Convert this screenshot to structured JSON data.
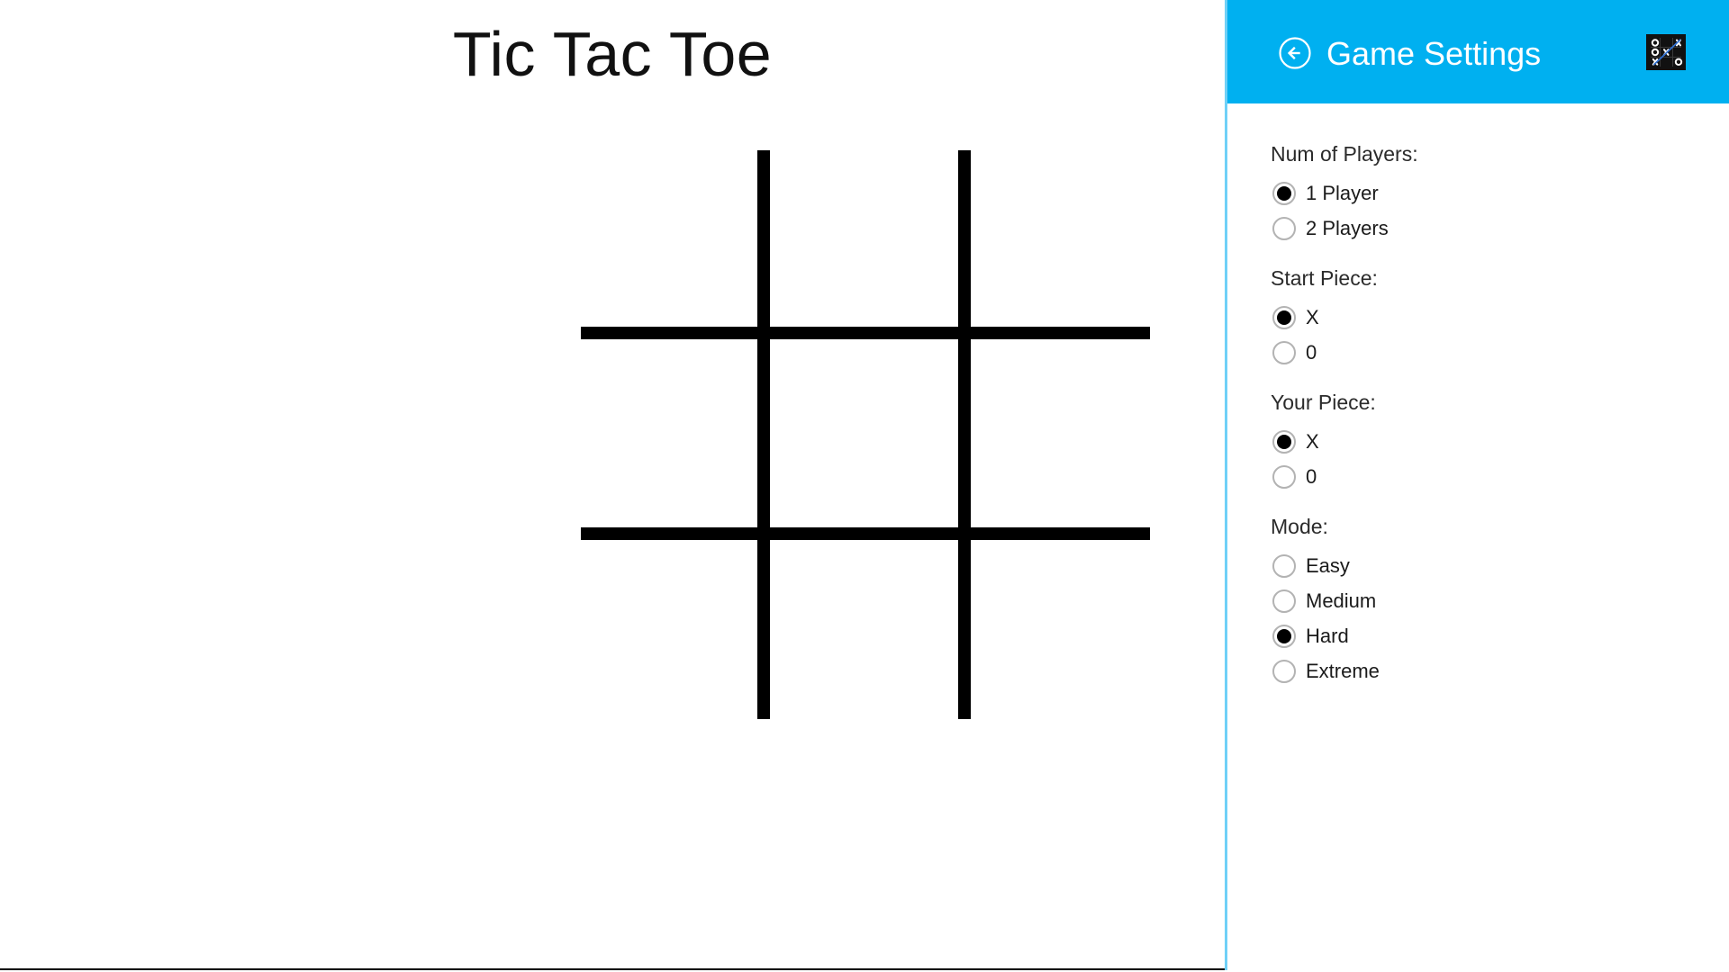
{
  "game": {
    "title": "Tic Tac Toe",
    "board": {
      "cells": [
        "",
        "",
        "",
        "",
        "",
        "",
        "",
        "",
        ""
      ],
      "line_color": "#000000"
    }
  },
  "settings": {
    "header": {
      "back_icon": "back-arrow-icon",
      "title": "Game Settings",
      "app_tile_icon": "tic-tac-toe-app-tile-icon",
      "accent_color": "#00b0f0",
      "border_color": "#6fd0f7"
    },
    "groups": [
      {
        "label": "Num of Players:",
        "name": "num-of-players",
        "options": [
          {
            "label": "1 Player",
            "checked": true
          },
          {
            "label": "2 Players",
            "checked": false
          }
        ]
      },
      {
        "label": "Start Piece:",
        "name": "start-piece",
        "options": [
          {
            "label": "X",
            "checked": true
          },
          {
            "label": "0",
            "checked": false
          }
        ]
      },
      {
        "label": "Your Piece:",
        "name": "your-piece",
        "options": [
          {
            "label": "X",
            "checked": true
          },
          {
            "label": "0",
            "checked": false
          }
        ]
      },
      {
        "label": "Mode:",
        "name": "mode",
        "options": [
          {
            "label": "Easy",
            "checked": false
          },
          {
            "label": "Medium",
            "checked": false
          },
          {
            "label": "Hard",
            "checked": true
          },
          {
            "label": "Extreme",
            "checked": false
          }
        ]
      }
    ]
  }
}
